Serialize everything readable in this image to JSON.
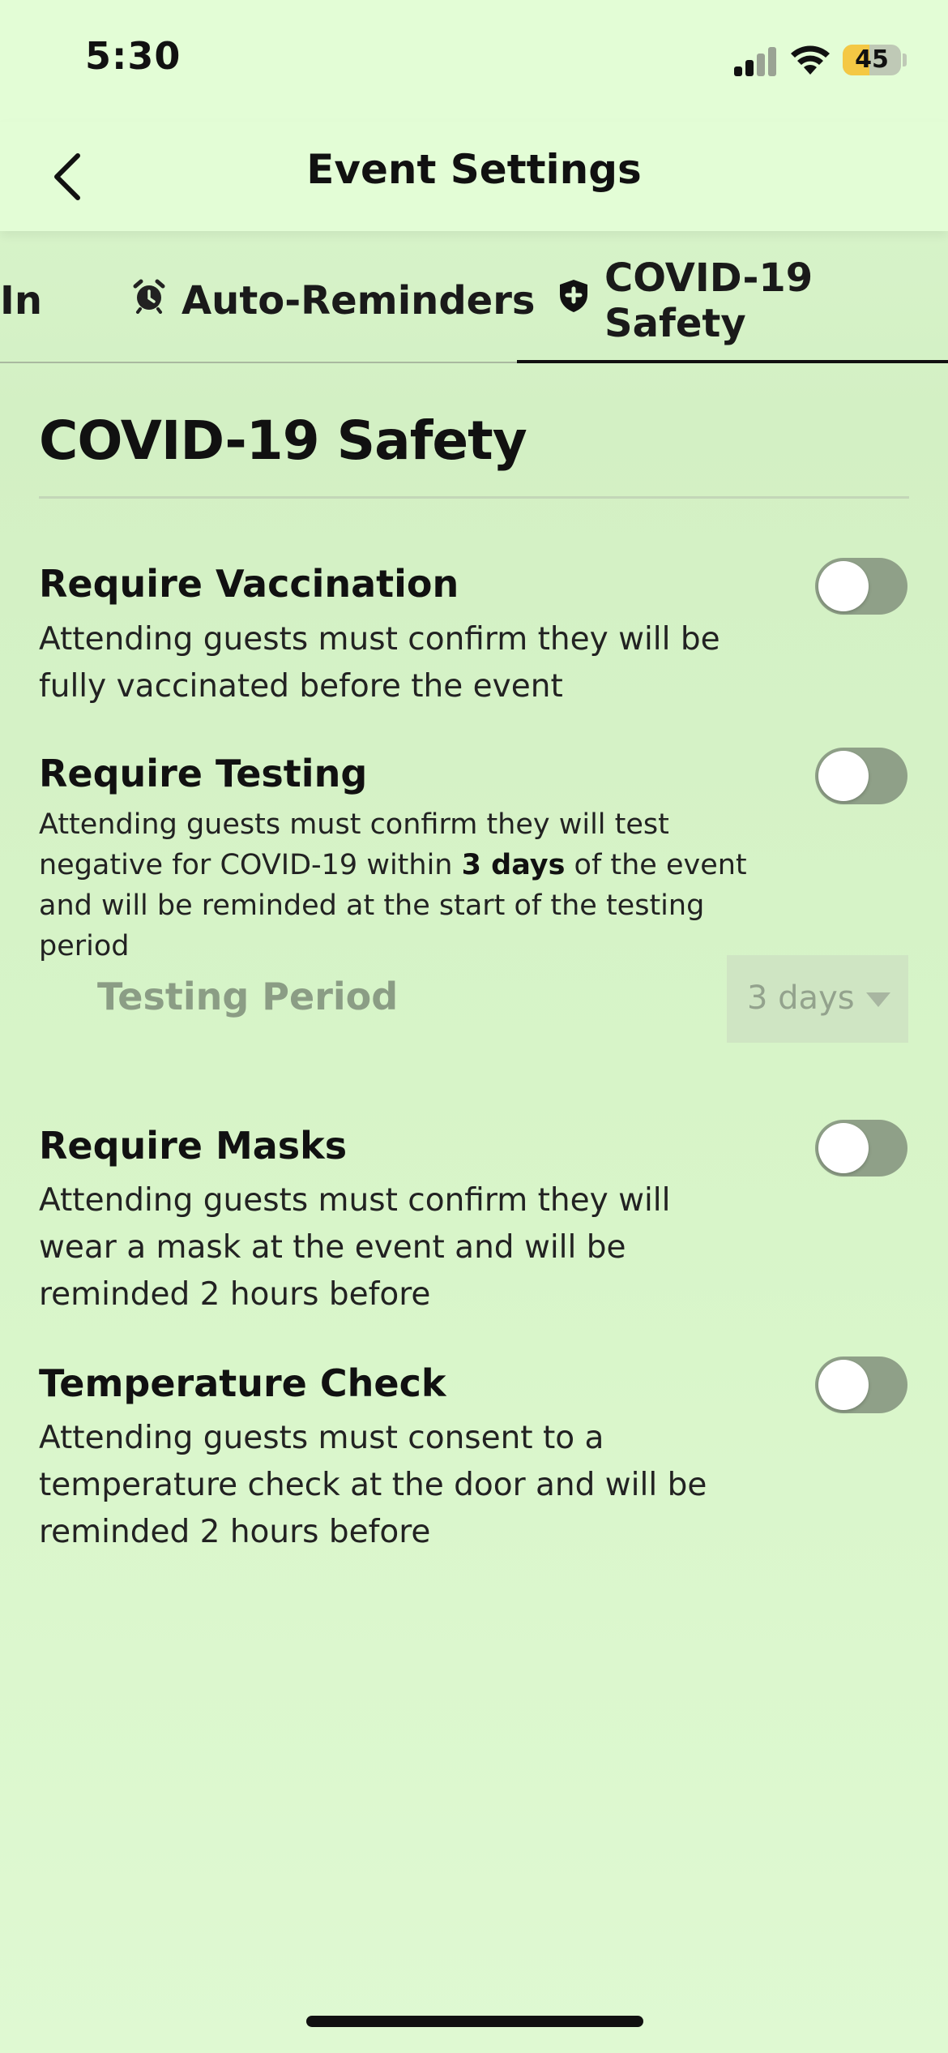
{
  "status_bar": {
    "time": "5:30",
    "battery_level": "45"
  },
  "nav": {
    "title": "Event Settings"
  },
  "tabs": [
    {
      "label": "In",
      "icon": "none"
    },
    {
      "label": "Auto-Reminders",
      "icon": "alarm-clock-icon"
    },
    {
      "label": "COVID-19 Safety",
      "icon": "shield-icon",
      "active": true
    }
  ],
  "section": {
    "title": "COVID-19 Safety"
  },
  "settings": {
    "vaccination": {
      "title": "Require Vaccination",
      "desc": "Attending guests must confirm they will be fully vaccinated before the event",
      "enabled": false
    },
    "testing": {
      "title": "Require Testing",
      "desc_part1": "Attending guests must confirm they will test negative for COVID-19 within ",
      "desc_bold": "3 days",
      "desc_part2": " of the event and will be reminded at the start of the testing period",
      "enabled": false,
      "period_label": "Testing Period",
      "period_value": "3 days"
    },
    "masks": {
      "title": "Require Masks",
      "desc": "Attending guests must confirm they will wear a mask at the event and will be reminded 2 hours before",
      "enabled": false
    },
    "temperature": {
      "title": "Temperature Check",
      "desc": "Attending guests must consent to a temperature check at the door and will be reminded 2 hours before",
      "enabled": false
    }
  },
  "colors": {
    "toggle_off": "#8fa088",
    "accent_text": "#111111",
    "background": "#d8f5c9"
  }
}
